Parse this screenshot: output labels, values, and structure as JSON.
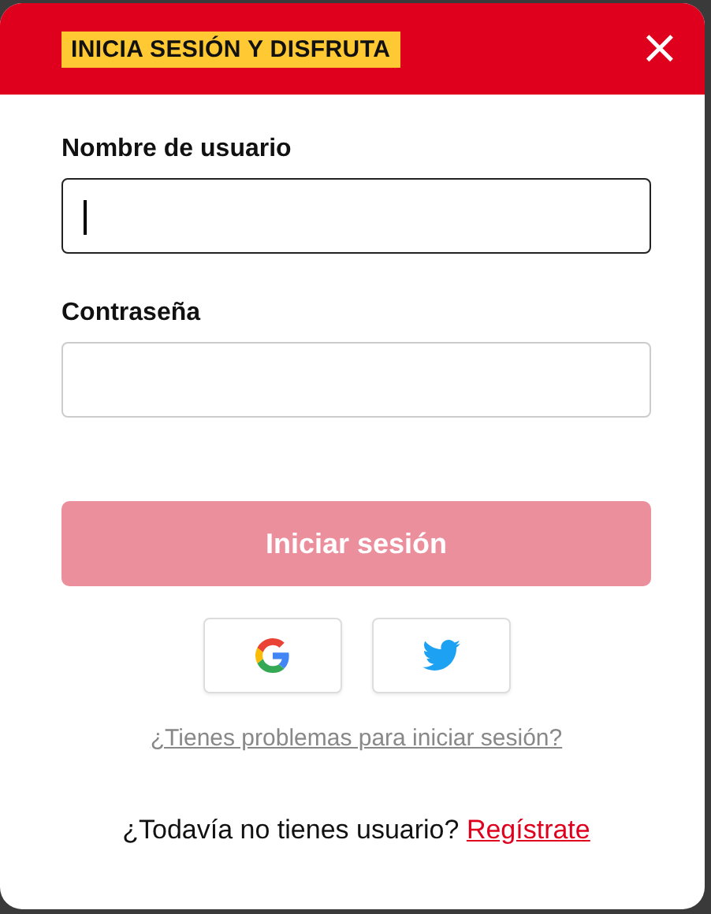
{
  "dialog": {
    "title": "INICIA SESIÓN Y DISFRUTA",
    "close": "×"
  },
  "fields": [
    {
      "label": "Nombre de usuario",
      "focused": true
    },
    {
      "label": "Contraseña",
      "focused": false
    }
  ],
  "submit": {
    "label": "Iniciar sesión",
    "disabled": true
  },
  "social": [
    {
      "kind": "google"
    },
    {
      "kind": "twitter"
    }
  ],
  "help_link": "¿Tienes problemas para iniciar sesión?",
  "footer": {
    "text": "¿Todavía no tienes usuario?",
    "link": "Regístrate"
  }
}
